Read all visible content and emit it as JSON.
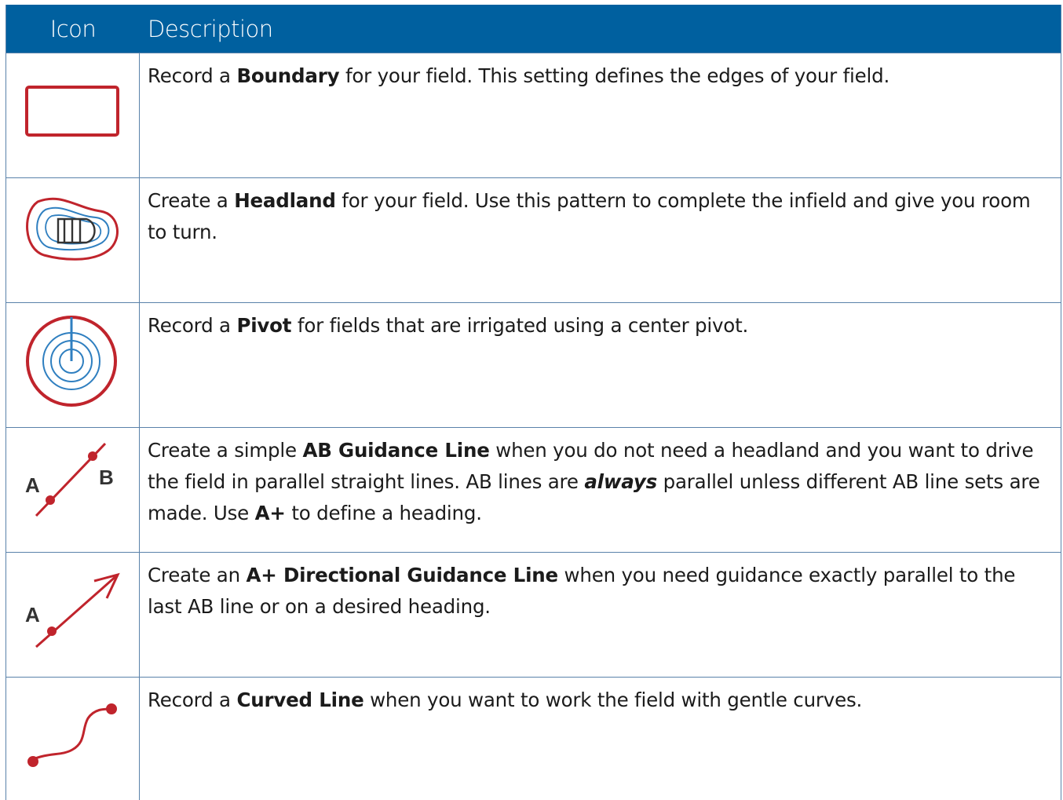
{
  "header": {
    "icon_col": "Icon",
    "desc_col": "Description"
  },
  "rows": [
    {
      "icon": "boundary-icon",
      "segments": [
        {
          "t": "Record a "
        },
        {
          "t": "Boundary",
          "b": 1
        },
        {
          "t": " for your field. This setting defines the edges of your field."
        }
      ]
    },
    {
      "icon": "headland-icon",
      "segments": [
        {
          "t": "Create a "
        },
        {
          "t": "Headland",
          "b": 1
        },
        {
          "t": " for your field. Use this pattern to complete the infield and give you room to turn."
        }
      ]
    },
    {
      "icon": "pivot-icon",
      "segments": [
        {
          "t": "Record a "
        },
        {
          "t": "Pivot",
          "b": 1
        },
        {
          "t": " for fields that are irrigated using a center pivot."
        }
      ]
    },
    {
      "icon": "ab-line-icon",
      "segments": [
        {
          "t": "Create a simple "
        },
        {
          "t": "AB Guidance Line",
          "b": 1
        },
        {
          "t": " when you do not need a headland and you want to drive the field in parallel straight lines. AB lines are "
        },
        {
          "t": "always",
          "b": 1,
          "i": 1
        },
        {
          "t": " parallel unless different AB line sets are made. Use "
        },
        {
          "t": "A+",
          "b": 1
        },
        {
          "t": " to define a heading."
        }
      ]
    },
    {
      "icon": "a-plus-line-icon",
      "segments": [
        {
          "t": "Create an "
        },
        {
          "t": "A+ Directional Guidance Line",
          "b": 1
        },
        {
          "t": " when you need guidance exactly parallel to the last AB line or on a desired heading."
        }
      ]
    },
    {
      "icon": "curved-line-icon",
      "segments": [
        {
          "t": "Record a "
        },
        {
          "t": "Curved Line",
          "b": 1
        },
        {
          "t": " when you want to work the field with gentle curves."
        }
      ]
    }
  ],
  "icon_labels": {
    "a": "A",
    "b": "B"
  },
  "colors": {
    "header": "#00609f",
    "icon_red": "#c0242c",
    "icon_blue": "#2f7fc0"
  }
}
